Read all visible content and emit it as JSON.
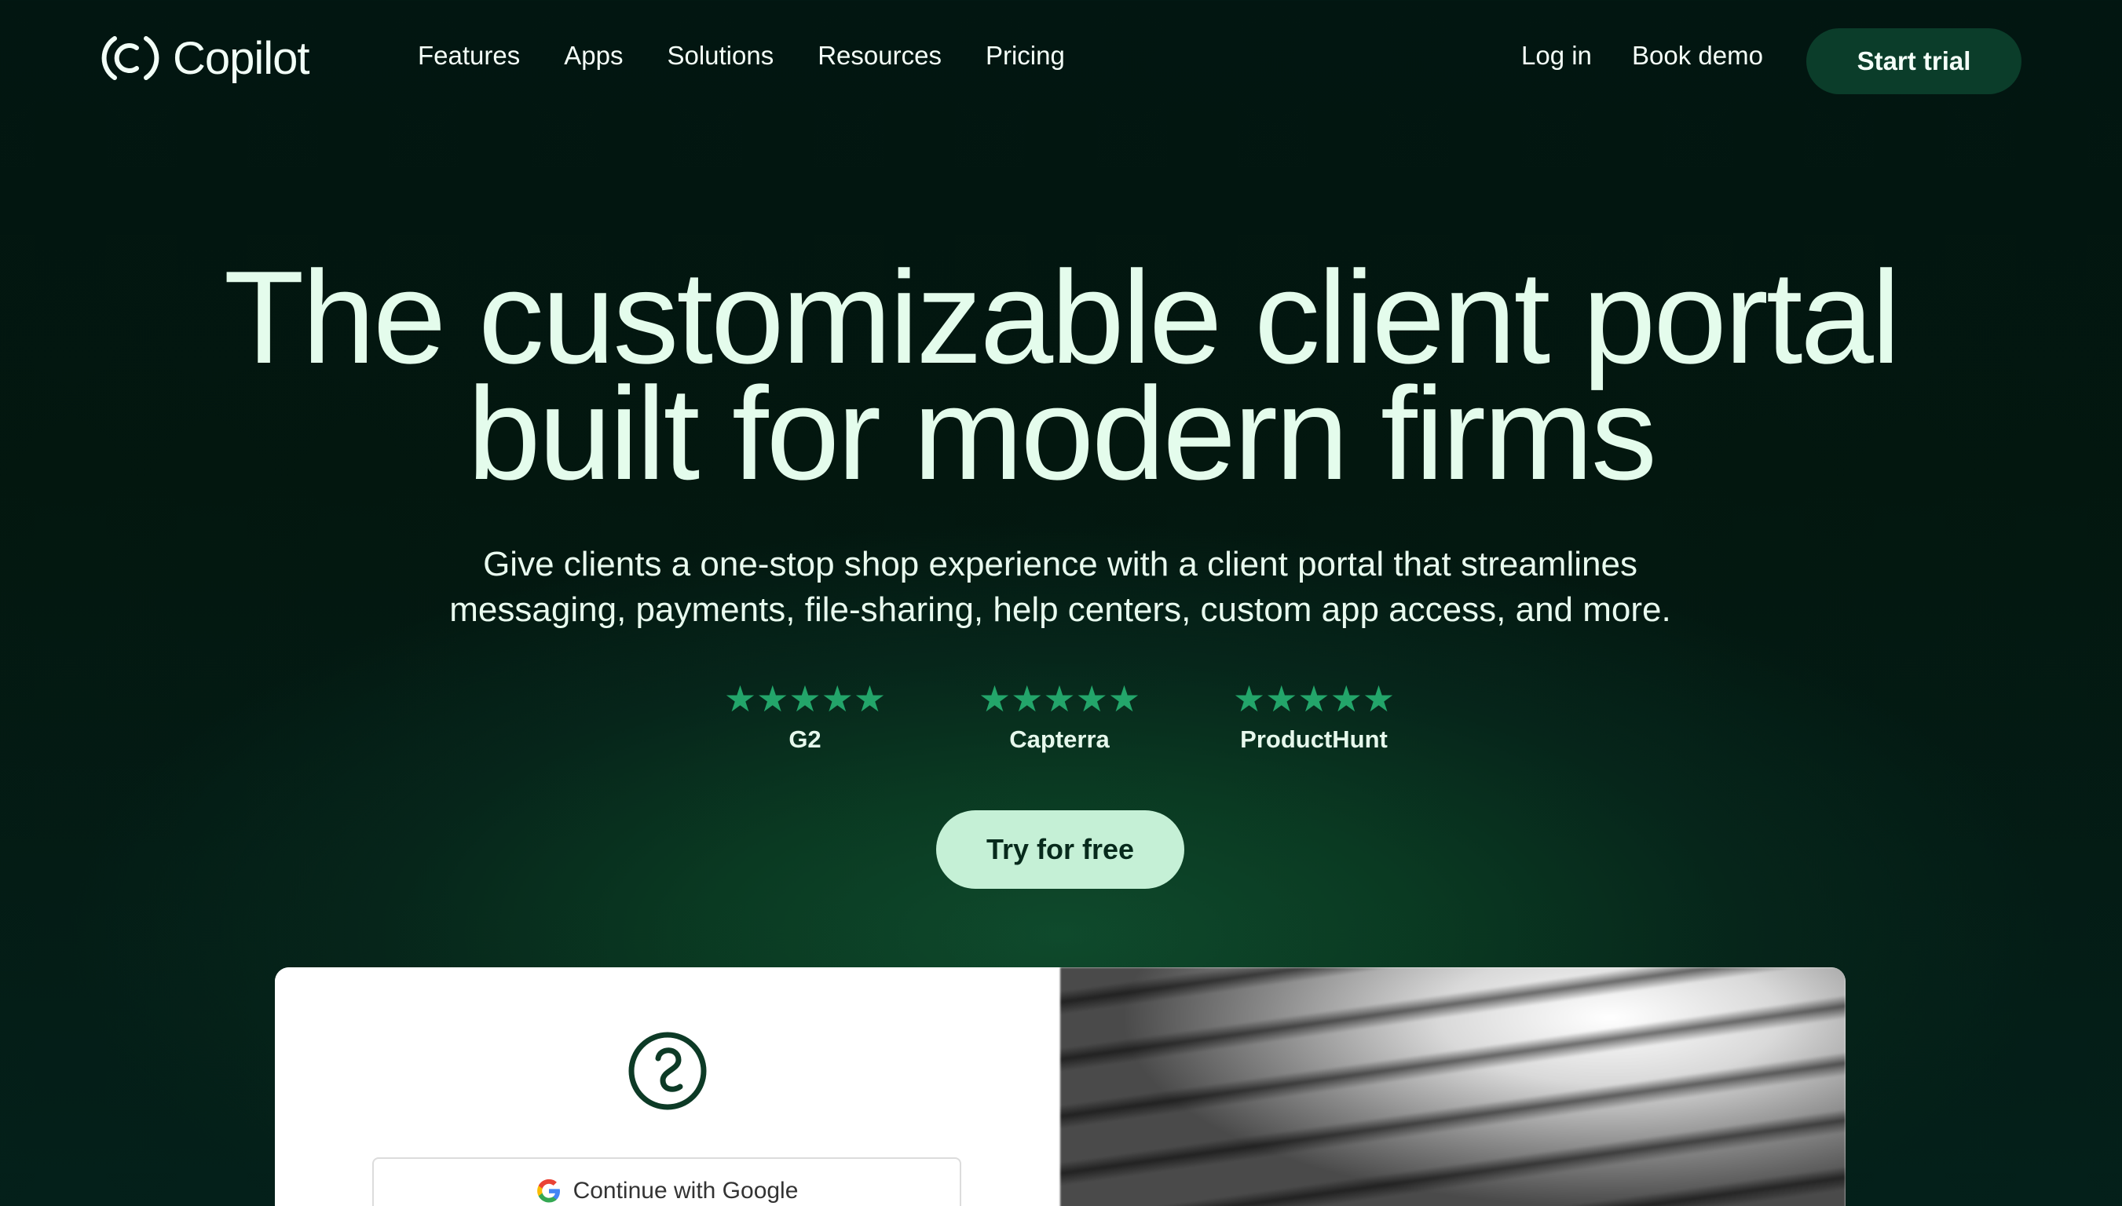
{
  "nav": {
    "logo_text": "Copilot",
    "links": [
      "Features",
      "Apps",
      "Solutions",
      "Resources",
      "Pricing"
    ],
    "login": "Log in",
    "book_demo": "Book demo",
    "start_trial": "Start trial"
  },
  "hero": {
    "headline_line1": "The customizable client portal",
    "headline_line2": "built for modern firms",
    "subtitle_line1": "Give clients a one-stop shop experience with a client portal that streamlines",
    "subtitle_line2": "messaging, payments, file-sharing, help centers, custom app access, and more.",
    "ratings": [
      {
        "source": "G2",
        "stars": "★★★★★",
        "rating": 5
      },
      {
        "source": "Capterra",
        "stars": "★★★★★",
        "rating": 5
      },
      {
        "source": "ProductHunt",
        "stars": "★★★★★",
        "rating": 5
      }
    ],
    "cta": "Try for free"
  },
  "preview": {
    "google_button": "Continue with Google"
  },
  "colors": {
    "background": "#021611",
    "glow": "#0f4a2c",
    "star": "#23a56a",
    "start_trial_bg": "#0b3d2a",
    "cta_bg": "#c5f0d6"
  }
}
